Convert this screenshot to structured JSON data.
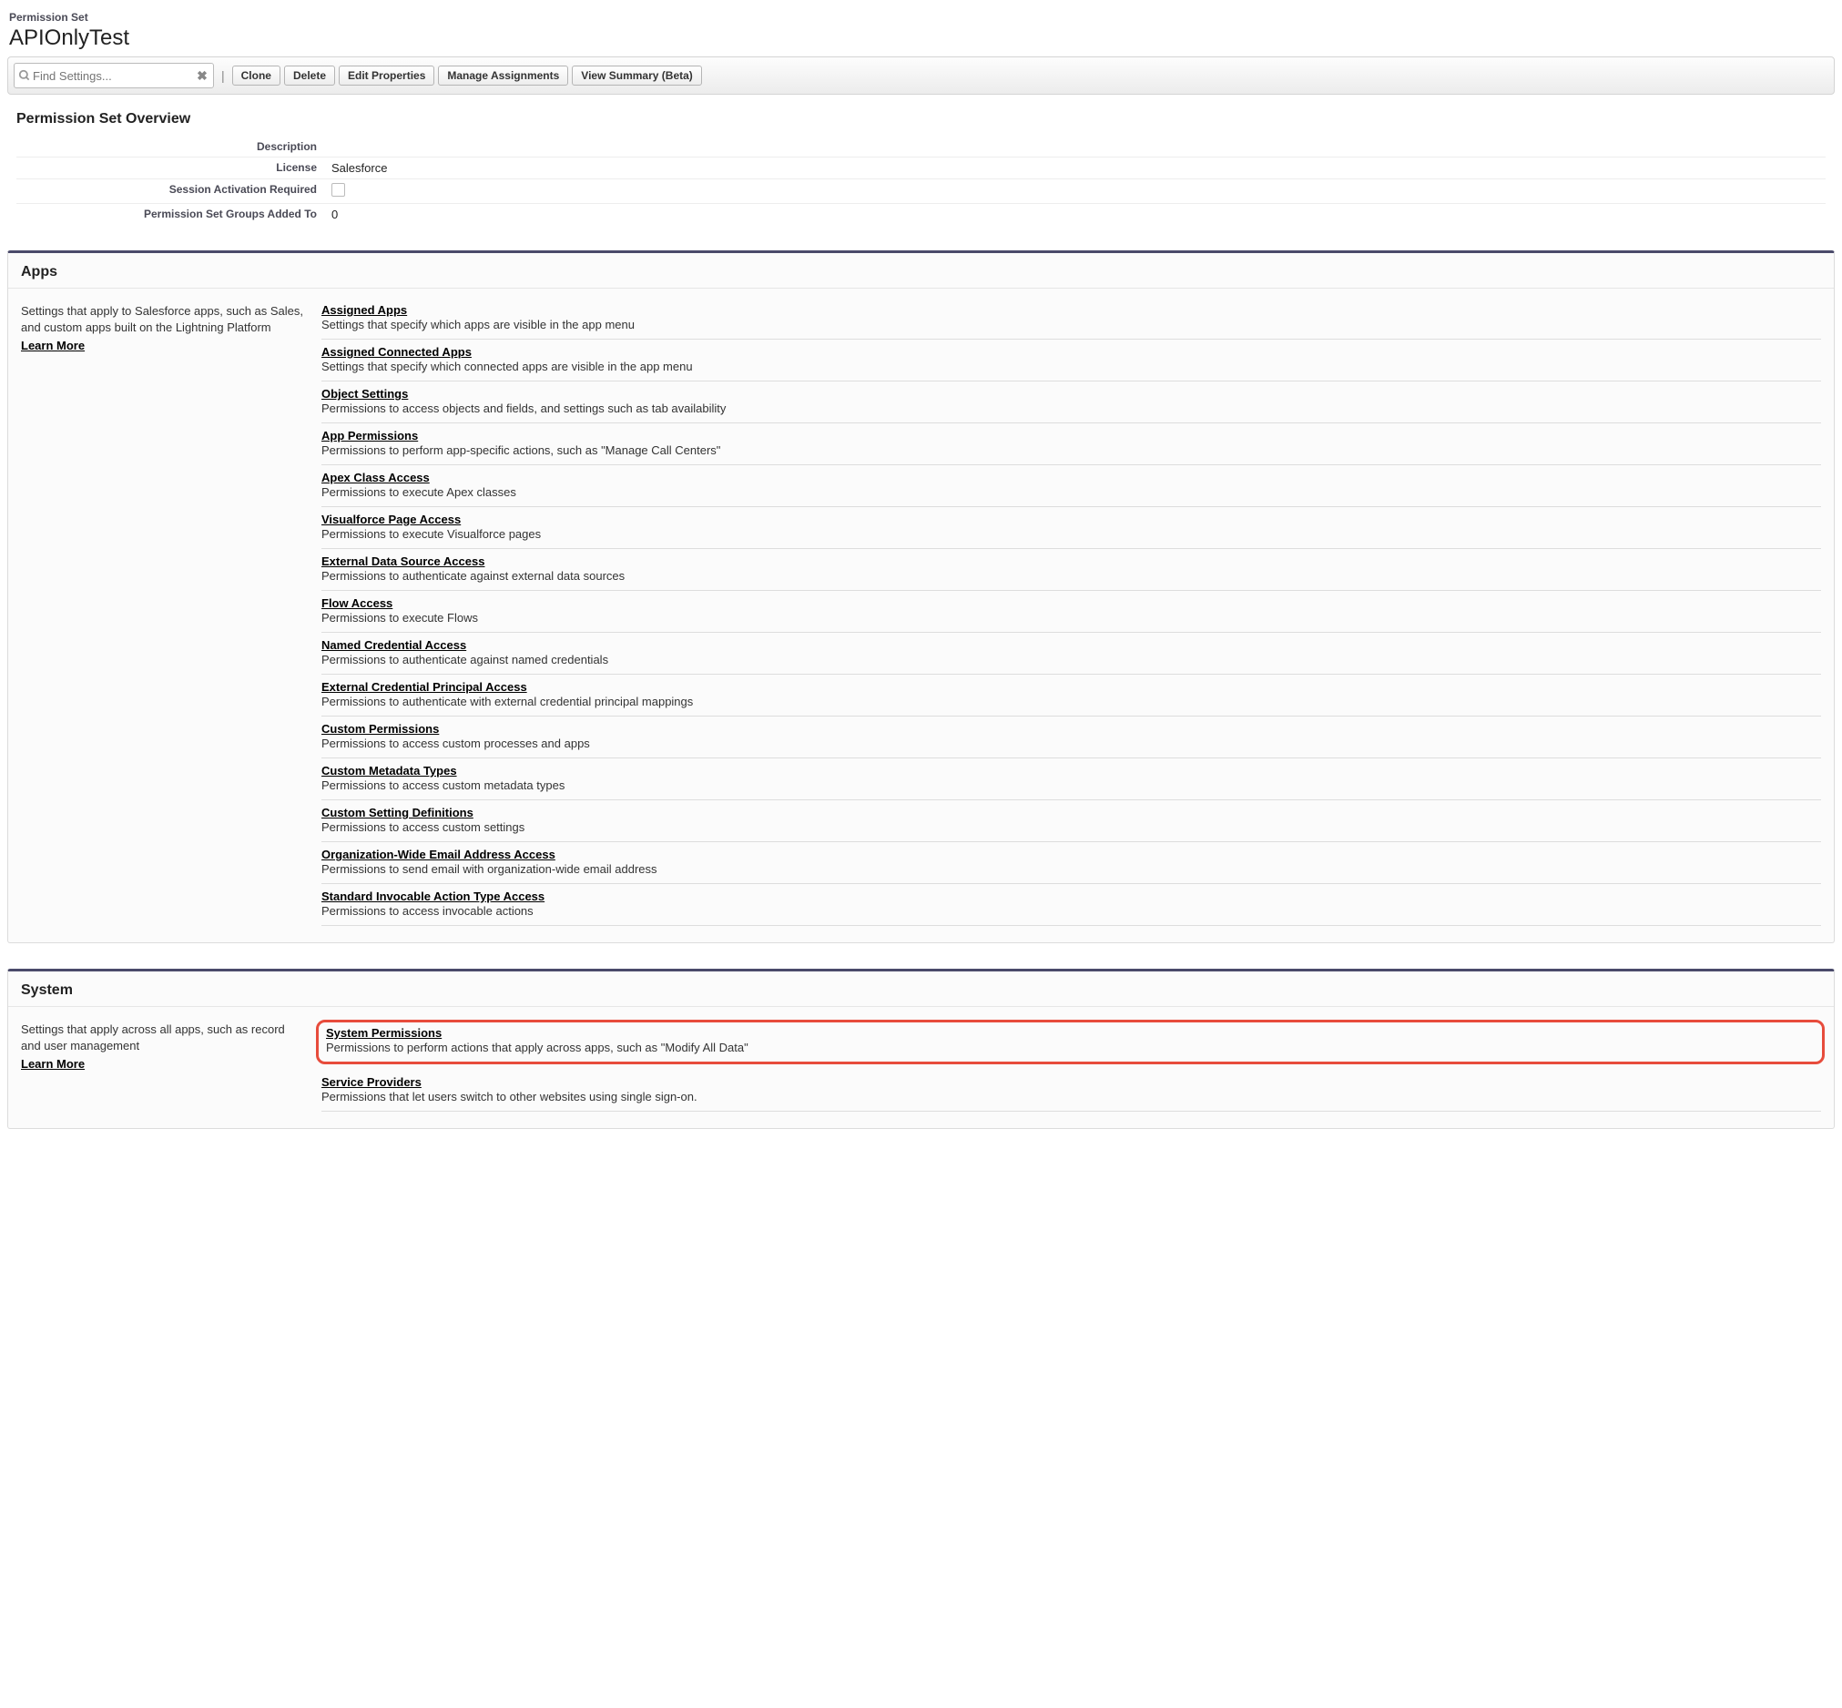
{
  "header": {
    "subtitle": "Permission Set",
    "title": "APIOnlyTest"
  },
  "toolbar": {
    "search_placeholder": "Find Settings...",
    "clone": "Clone",
    "delete": "Delete",
    "edit_properties": "Edit Properties",
    "manage_assignments": "Manage Assignments",
    "view_summary": "View Summary (Beta)"
  },
  "overview": {
    "title": "Permission Set Overview",
    "rows": {
      "description_label": "Description",
      "description_value": "",
      "license_label": "License",
      "license_value": "Salesforce",
      "session_label": "Session Activation Required",
      "groups_label": "Permission Set Groups Added To",
      "groups_value": "0"
    }
  },
  "apps": {
    "title": "Apps",
    "desc": "Settings that apply to Salesforce apps, such as Sales, and custom apps built on the Lightning Platform",
    "learn_more": "Learn More",
    "items": [
      {
        "title": "Assigned Apps",
        "sub": "Settings that specify which apps are visible in the app menu"
      },
      {
        "title": "Assigned Connected Apps",
        "sub": "Settings that specify which connected apps are visible in the app menu"
      },
      {
        "title": "Object Settings",
        "sub": "Permissions to access objects and fields, and settings such as tab availability"
      },
      {
        "title": "App Permissions",
        "sub": "Permissions to perform app-specific actions, such as \"Manage Call Centers\""
      },
      {
        "title": "Apex Class Access",
        "sub": "Permissions to execute Apex classes"
      },
      {
        "title": "Visualforce Page Access",
        "sub": "Permissions to execute Visualforce pages"
      },
      {
        "title": "External Data Source Access",
        "sub": "Permissions to authenticate against external data sources"
      },
      {
        "title": "Flow Access",
        "sub": "Permissions to execute Flows"
      },
      {
        "title": "Named Credential Access",
        "sub": "Permissions to authenticate against named credentials"
      },
      {
        "title": "External Credential Principal Access",
        "sub": "Permissions to authenticate with external credential principal mappings"
      },
      {
        "title": "Custom Permissions",
        "sub": "Permissions to access custom processes and apps"
      },
      {
        "title": "Custom Metadata Types",
        "sub": "Permissions to access custom metadata types"
      },
      {
        "title": "Custom Setting Definitions",
        "sub": "Permissions to access custom settings"
      },
      {
        "title": "Organization-Wide Email Address Access",
        "sub": "Permissions to send email with organization-wide email address"
      },
      {
        "title": "Standard Invocable Action Type Access",
        "sub": "Permissions to access invocable actions"
      }
    ]
  },
  "system": {
    "title": "System",
    "desc": "Settings that apply across all apps, such as record and user management",
    "learn_more": "Learn More",
    "items": [
      {
        "title": "System Permissions",
        "sub": "Permissions to perform actions that apply across apps, such as \"Modify All Data\"",
        "highlight": true
      },
      {
        "title": "Service Providers",
        "sub": "Permissions that let users switch to other websites using single sign-on."
      }
    ]
  }
}
